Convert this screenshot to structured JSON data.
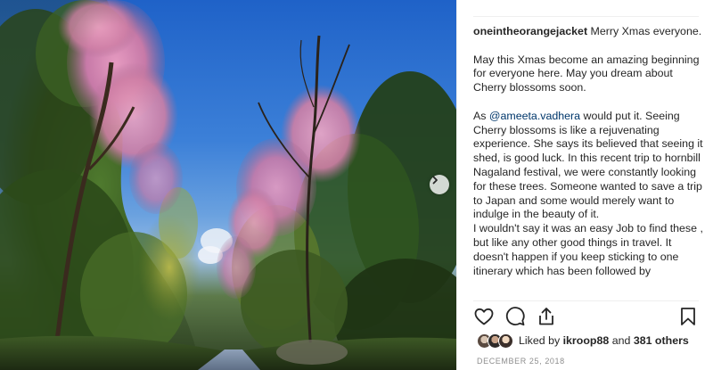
{
  "post": {
    "username": "oneintheorangejacket",
    "caption_first": "Merry Xmas everyone.",
    "para2": "May this Xmas become an amazing beginning for everyone here. May you dream about Cherry blossoms soon.",
    "para3_prefix": "As ",
    "mention": "@ameeta.vadhera",
    "para3_rest": " would put it. Seeing Cherry blossoms is like a rejuvenating experience. She says its believed that seeing it shed, is good luck. In this recent trip to hornbill Nagaland festival, we were constantly looking for these trees. Someone wanted to save a trip to Japan and some would merely want to indulge in the beauty of it.",
    "para4": "I wouldn't say it was an easy Job to find these , but like any other good things in travel. It doesn't happen if you keep sticking to one itinerary which has been followed by"
  },
  "likes": {
    "prefix": "Liked by ",
    "user": "ikroop88",
    "middle": " and ",
    "count": "381 others"
  },
  "date": "DECEMBER 25, 2018",
  "icons": {
    "like": "heart-icon",
    "comment": "comment-icon",
    "share": "share-icon",
    "save": "bookmark-icon",
    "next": "chevron-right-icon"
  },
  "colors": {
    "text": "#262626",
    "mention": "#00376b",
    "muted": "#8e8e8e",
    "divider": "#efefef"
  }
}
